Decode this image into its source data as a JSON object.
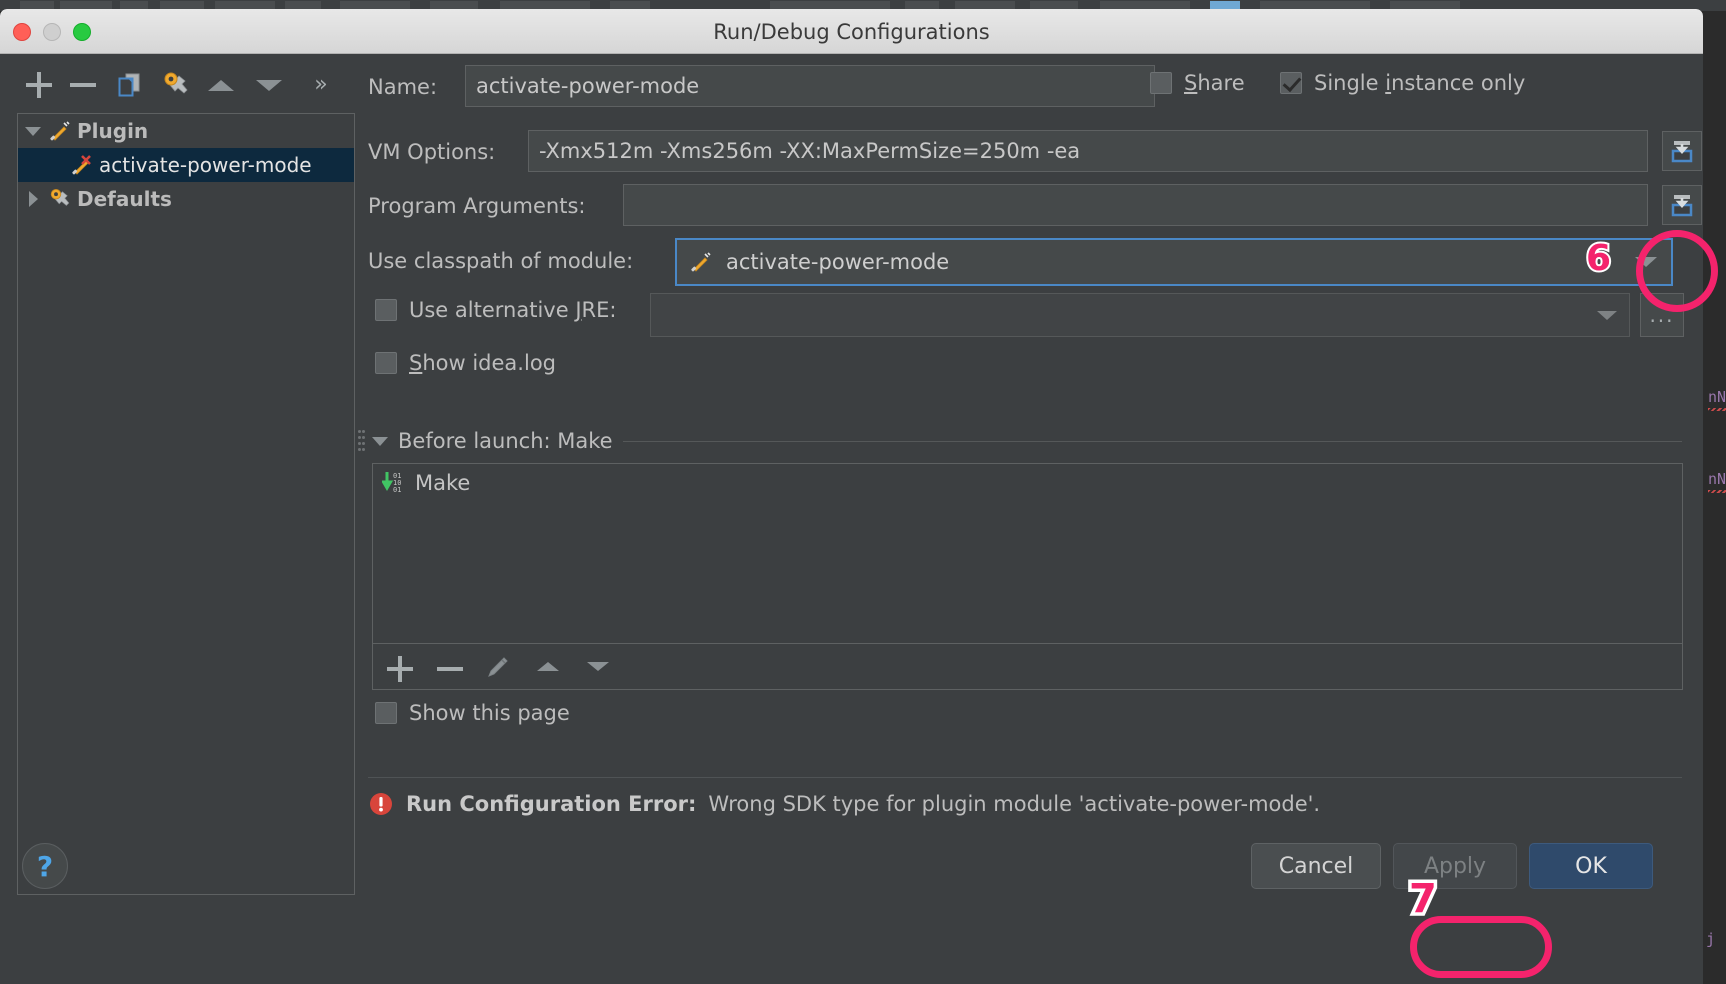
{
  "window": {
    "title": "Run/Debug Configurations",
    "traffic_lights": [
      "close",
      "minimize",
      "zoom"
    ]
  },
  "left_toolbar": {
    "buttons": [
      {
        "name": "add",
        "icon": "plus-icon",
        "label": "+"
      },
      {
        "name": "remove",
        "icon": "minus-icon",
        "label": "−"
      },
      {
        "name": "copy",
        "icon": "copy-configuration-icon",
        "label": ""
      },
      {
        "name": "edit-defaults",
        "icon": "wrench-gear-icon",
        "label": ""
      },
      {
        "name": "move-up",
        "icon": "triangle-up-icon",
        "label": ""
      },
      {
        "name": "move-down",
        "icon": "triangle-down-icon",
        "label": ""
      },
      {
        "name": "more",
        "icon": "chevrons-right-icon",
        "label": "»"
      }
    ]
  },
  "tree": {
    "items": [
      {
        "label": "Plugin",
        "level": 0,
        "expanded": true,
        "icon": "plugin-icon",
        "selected": false,
        "bold": true
      },
      {
        "label": "activate-power-mode",
        "level": 1,
        "expanded": null,
        "icon": "plugin-error-icon",
        "selected": true,
        "bold": false
      },
      {
        "label": "Defaults",
        "level": 0,
        "expanded": false,
        "icon": "wrench-gear-icon",
        "selected": false,
        "bold": true
      }
    ]
  },
  "form": {
    "name_label": "Name:",
    "name_value": "activate-power-mode",
    "share_label": "Share",
    "share_mnemonic": "S",
    "share_checked": false,
    "single_instance_label": "Single instance only",
    "single_instance_mnemonic": "i",
    "single_instance_checked": true,
    "vm_options_label": "VM Options:",
    "vm_options_value": "-Xmx512m -Xms256m -XX:MaxPermSize=250m -ea",
    "program_args_label": "Program Arguments:",
    "program_args_value": "",
    "classpath_label": "Use classpath of module:",
    "classpath_value": "activate-power-mode",
    "alt_jre_label": "Use alternative JRE:",
    "alt_jre_mnemonic": "J",
    "alt_jre_checked": false,
    "alt_jre_value": "",
    "show_idea_log_label": "Show idea.log",
    "show_idea_log_mnemonic": "S",
    "show_idea_log_checked": false,
    "expand_button_icon": "expand-editor-icon"
  },
  "before_launch": {
    "header": "Before launch: Make",
    "items": [
      {
        "label": "Make",
        "icon": "compile-make-icon"
      }
    ],
    "toolbar": [
      {
        "name": "add-task",
        "icon": "plus-icon"
      },
      {
        "name": "remove-task",
        "icon": "minus-icon"
      },
      {
        "name": "edit-task",
        "icon": "pencil-icon"
      },
      {
        "name": "move-task-up",
        "icon": "triangle-up-icon"
      },
      {
        "name": "move-task-down",
        "icon": "triangle-down-icon"
      }
    ],
    "show_this_page_label": "Show this page",
    "show_this_page_checked": false
  },
  "error": {
    "icon": "error-exclamation-icon",
    "title": "Run Configuration Error:",
    "message": "Wrong SDK type for plugin module 'activate-power-mode'."
  },
  "footer": {
    "help_label": "?",
    "cancel_label": "Cancel",
    "apply_label": "Apply",
    "ok_label": "OK"
  },
  "annotations": [
    {
      "number": "6",
      "target": "classpath-dropdown-arrow"
    },
    {
      "number": "7",
      "target": "apply-button"
    }
  ],
  "colors": {
    "annotation_pink": "#f4236c",
    "selection_blue": "#0d293e",
    "focus_ring_blue": "#4a88c7",
    "ok_button_blue": "#2f4a6b",
    "panel_bg": "#3c3f41",
    "field_bg": "#45494a",
    "text": "#bdbdbd"
  }
}
